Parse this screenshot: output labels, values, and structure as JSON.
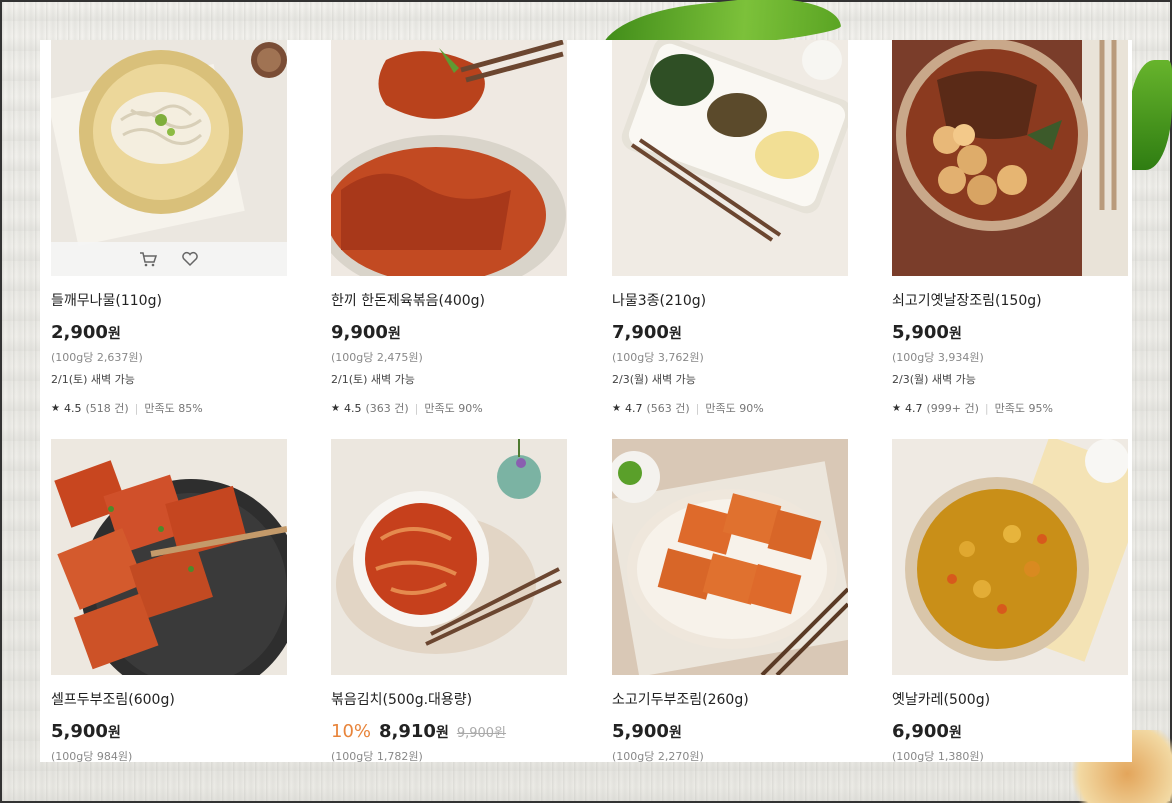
{
  "products": [
    {
      "name": "들깨무나물(110g)",
      "price": "2,900",
      "won": "원",
      "unit_price": "(100g당 2,637원)",
      "delivery": "2/1(토) 새벽 가능",
      "rating": "4.5",
      "reviews": "(518 건)",
      "satisfaction": "만족도 85%",
      "image": "radish-namul"
    },
    {
      "name": "한끼 한돈제육볶음(400g)",
      "price": "9,900",
      "won": "원",
      "unit_price": "(100g당 2,475원)",
      "delivery": "2/1(토) 새벽 가능",
      "rating": "4.5",
      "reviews": "(363 건)",
      "satisfaction": "만족도 90%",
      "image": "spicy-pork"
    },
    {
      "name": "나물3종(210g)",
      "price": "7,900",
      "won": "원",
      "unit_price": "(100g당 3,762원)",
      "delivery": "2/3(월) 새벽 가능",
      "rating": "4.7",
      "reviews": "(563 건)",
      "satisfaction": "만족도 90%",
      "image": "namul-set"
    },
    {
      "name": "쇠고기옛날장조림(150g)",
      "price": "5,900",
      "won": "원",
      "unit_price": "(100g당 3,934원)",
      "delivery": "2/3(월) 새벽 가능",
      "rating": "4.7",
      "reviews": "(999+ 건)",
      "satisfaction": "만족도 95%",
      "image": "beef-jangjorim"
    },
    {
      "name": "셀프두부조림(600g)",
      "price": "5,900",
      "won": "원",
      "unit_price": "(100g당 984원)",
      "image": "tofu-braised"
    },
    {
      "name": "볶음김치(500g.대용량)",
      "discount": "10%",
      "price": "8,910",
      "won": "원",
      "original_price": "9,900원",
      "unit_price": "(100g당 1,782원)",
      "image": "stir-fried-kimchi"
    },
    {
      "name": "소고기두부조림(260g)",
      "price": "5,900",
      "won": "원",
      "unit_price": "(100g당 2,270원)",
      "image": "beef-tofu"
    },
    {
      "name": "옛날카레(500g)",
      "price": "6,900",
      "won": "원",
      "unit_price": "(100g당 1,380원)",
      "image": "curry"
    }
  ],
  "icons": {
    "cart": "cart-icon",
    "wishlist": "heart-icon",
    "star": "★"
  },
  "colors": {
    "discount": "#e8843a",
    "panel": "#ffffff"
  }
}
